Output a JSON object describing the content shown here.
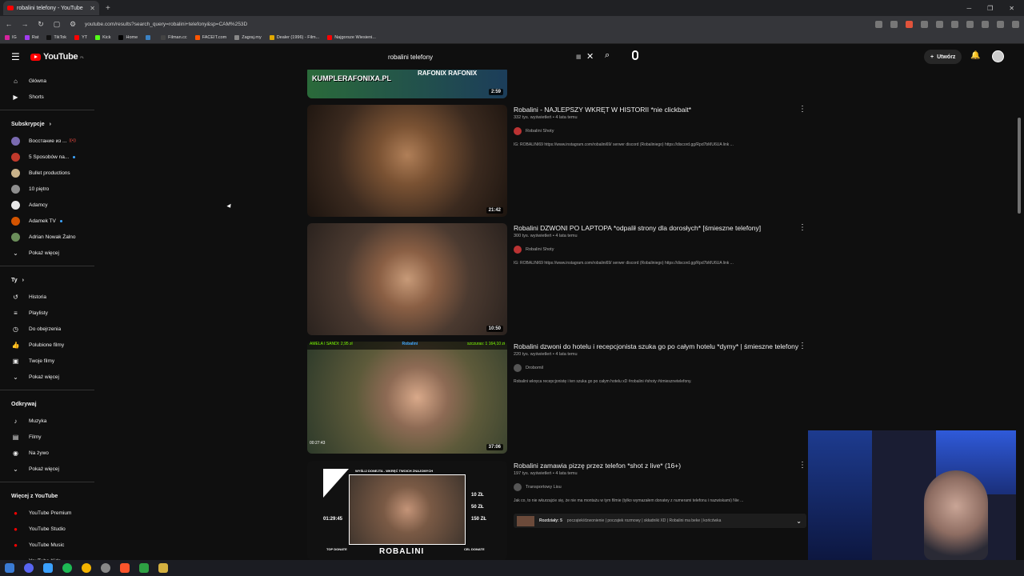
{
  "browser": {
    "tab_title": "robalini telefony - YouTube",
    "url": "youtube.com/results?search_query=robalini+telefony&sp=CAM%253D",
    "bookmarks": [
      "IG",
      "Rat",
      "TikTok",
      "YT",
      "Kick",
      "Home",
      "",
      "Filman.cc",
      "FACEIT.com",
      "Zagraj.my",
      "Dealer (1996) - Film...",
      "Najgorsze Wiesieni..."
    ]
  },
  "masthead": {
    "logo_text": "YouTube",
    "logo_region": "PL",
    "search_query": "robalini telefony",
    "create_label": "Utwórz"
  },
  "sidebar": {
    "main": [
      {
        "label": "Główna",
        "icon": "home-icon"
      },
      {
        "label": "Shorts",
        "icon": "shorts-icon"
      }
    ],
    "subs_header": "Subskrypcje",
    "subs": [
      {
        "label": "Восстание из ...",
        "color": "#7a6ab0",
        "badge": "live"
      },
      {
        "label": "5 Sposobów na...",
        "color": "#c0392b",
        "badge": "dot"
      },
      {
        "label": "Bullet productions",
        "color": "#c9b28a",
        "badge": ""
      },
      {
        "label": "10 piętro",
        "color": "#8e8e8e",
        "badge": ""
      },
      {
        "label": "Adamcy",
        "color": "#e8e8e8",
        "badge": ""
      },
      {
        "label": "Adamek TV",
        "color": "#d35400",
        "badge": "dot"
      },
      {
        "label": "Adrian Nowak Żalno",
        "color": "#6b8e5a",
        "badge": ""
      }
    ],
    "subs_more": "Pokaż więcej",
    "you_header": "Ty",
    "you": [
      {
        "label": "Historia",
        "icon": "history-icon"
      },
      {
        "label": "Playlisty",
        "icon": "playlist-icon"
      },
      {
        "label": "Do obejrzenia",
        "icon": "watch-later-icon"
      },
      {
        "label": "Polubione filmy",
        "icon": "like-icon"
      },
      {
        "label": "Twoje filmy",
        "icon": "your-videos-icon"
      }
    ],
    "you_more": "Pokaż więcej",
    "explore_header": "Odkrywaj",
    "explore": [
      {
        "label": "Muzyka",
        "icon": "music-icon"
      },
      {
        "label": "Filmy",
        "icon": "film-icon"
      },
      {
        "label": "Na żywo",
        "icon": "live-icon"
      }
    ],
    "explore_more": "Pokaż więcej",
    "more_header": "Więcej z YouTube",
    "more": [
      {
        "label": "YouTube Premium"
      },
      {
        "label": "YouTube Studio"
      },
      {
        "label": "YouTube Music"
      },
      {
        "label": "YouTube Kids"
      }
    ]
  },
  "results": {
    "partial_thumb": {
      "duration": "2:59",
      "text1": "KUMPLERAFONIXA.PL",
      "text2": "RAFONIX RAFONIX"
    },
    "videos": [
      {
        "title": "Robalini - NAJLEPSZY WKRĘT W HISTORII *nie clickbait*",
        "stats": "332 tys. wyświetleń • 4 lata temu",
        "channel": "Robalini Shoty",
        "desc": "IG: ROBALINI69 https://www.instagram.com/robalini69/ serwer discord (Robaliniego) https://discord.gg/Rpd7bMU6UA link ...",
        "duration": "21:42"
      },
      {
        "title": "Robalini DZWONI PO LAPTOPA *odpalił strony dla dorosłych* [śmieszne telefony]",
        "stats": "300 tys. wyświetleń • 4 lata temu",
        "channel": "Robalini Shoty",
        "desc": "IG: ROBALINI69 https://www.instagram.com/robalini69/ serwer discord (Robaliniego) https://discord.gg/Rpd7bMU6UA link ...",
        "duration": "10:50"
      },
      {
        "title": "Robalini dzwoni do hotelu i recepcjonista szuka go po całym hotelu *dymy* | śmieszne telefony",
        "stats": "220 tys. wyświetleń • 4 lata temu",
        "channel": "Drobomil",
        "desc": "Robalini wkręca recepcjonistę i ten szuka go po całym hotelu xD #robalini #shoty #śmiesznetelefony.",
        "duration": "37:06",
        "overlay_left": "AMELA I SANDI: 2,95 zł",
        "overlay_right": "szczuras: 1 164,10 zł",
        "overlay_brand": "Robalini",
        "timer": "00:27:43"
      },
      {
        "title": "Robalini zamawia pizzę przez telefon *shot z live* (16+)",
        "stats": "197 tys. wyświetleń • 4 lata temu",
        "channel": "Transportowy Lisu",
        "desc": "Jak co, to nie wkurzajcie się, że nie ma montażu w tym filmie (tylko wymazałem donatey z numerami telefonu i nazwiskami) Nie ...",
        "chapters_label": "Rozdziały: 5",
        "chapters_text": "początek/dzwonienie | początek rozmowy | składniki XD | Robalini ma beke | końcówka",
        "thumb_banner": "WYŚLIJ DONEJTA - WKRĘĆ TWOICH ZNAJOMYCH",
        "thumb_timer": "01:29:45",
        "prices": [
          "10 ZŁ",
          "50 ZŁ",
          "150 ZŁ"
        ],
        "thumb_brand": "ROBALINI",
        "top_donate": "TOP DONATE",
        "cel_donate": "CEL DONATE"
      }
    ]
  }
}
